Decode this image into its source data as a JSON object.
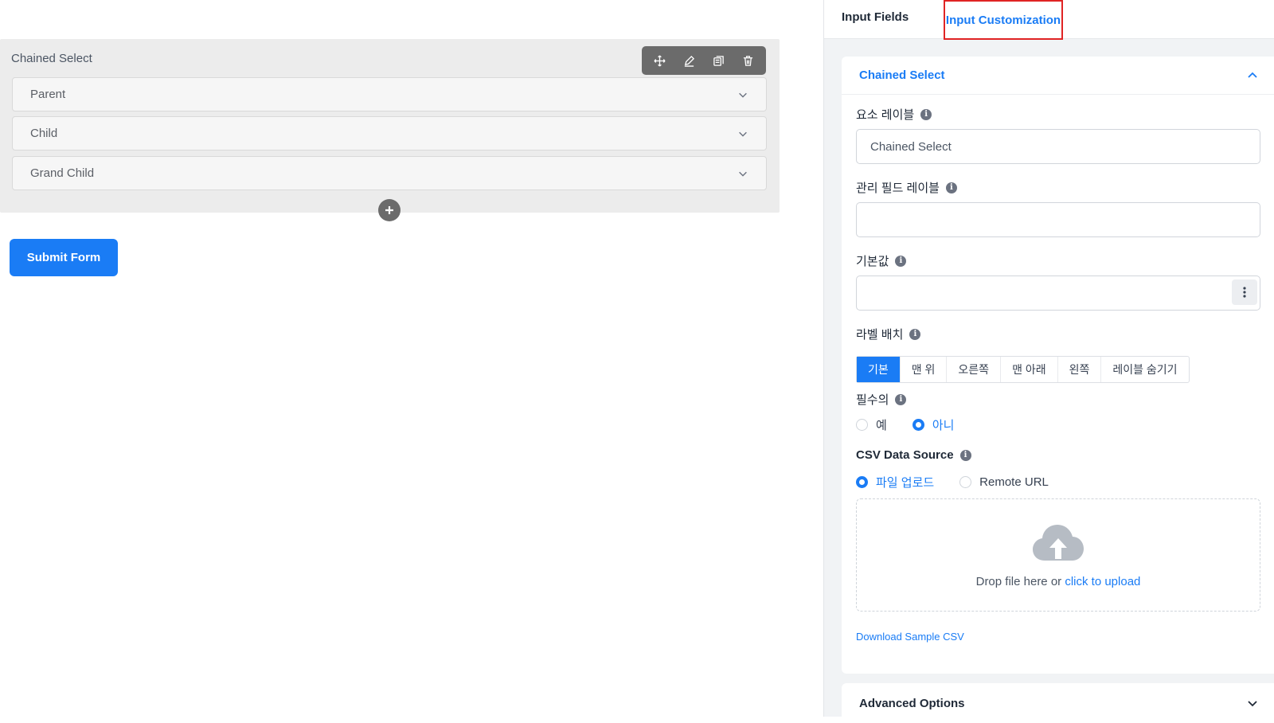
{
  "form": {
    "field_title": "Chained Select",
    "selects": [
      "Parent",
      "Child",
      "Grand Child"
    ],
    "submit_label": "Submit Form"
  },
  "tabs": {
    "input_fields": "Input Fields",
    "input_customization": "Input Customization"
  },
  "panel": {
    "title": "Chained Select",
    "element_label": {
      "label": "요소 레이블",
      "value": "Chained Select"
    },
    "admin_label": {
      "label": "관리 필드 레이블",
      "value": ""
    },
    "default_value": {
      "label": "기본값",
      "value": ""
    },
    "label_placement": {
      "label": "라벨 배치",
      "options": [
        "기본",
        "맨 위",
        "오른쪽",
        "맨 아래",
        "왼쪽",
        "레이블 숨기기"
      ],
      "selected": "기본"
    },
    "required": {
      "label": "필수의",
      "options": [
        "예",
        "아니"
      ],
      "selected": "아니"
    },
    "csv_source": {
      "label": "CSV Data Source",
      "options": [
        "파일 업로드",
        "Remote URL"
      ],
      "selected": "파일 업로드"
    },
    "upload": {
      "text": "Drop file here or ",
      "link": "click to upload"
    },
    "sample_link": "Download Sample CSV"
  },
  "advanced": {
    "title": "Advanced Options"
  },
  "colors": {
    "accent": "#1a7cf5",
    "highlight_border": "#e02424",
    "toolbar": "#6b6b6b"
  }
}
